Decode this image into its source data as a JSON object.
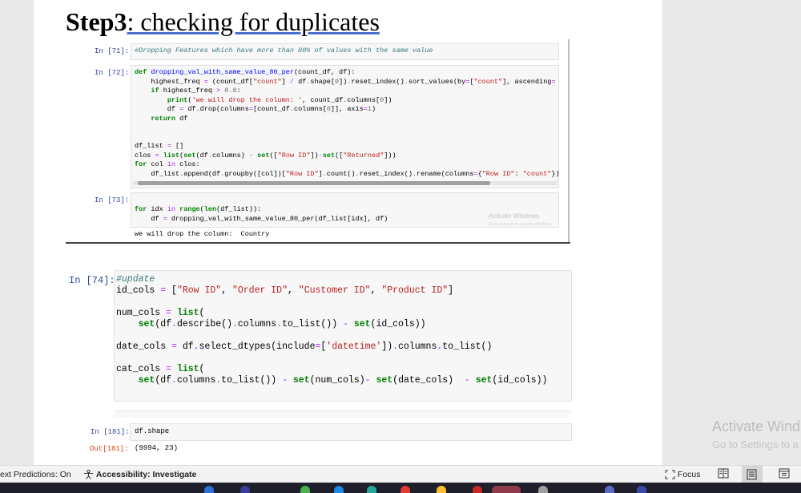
{
  "document": {
    "title_bold": "Step3",
    "title_rest": ": checking for duplicates"
  },
  "small_notebook": {
    "cells": [
      {
        "prompt": "In [71]:",
        "code": "#Dropping Features which have more than 80% of values with the same value"
      },
      {
        "prompt": "In [72]:",
        "lines": [
          "def dropping_val_with_same_value_80_per(count_df, df):",
          "    highest_freq = (count_df[\"count\"] / df.shape[0]).reset_index().sort_values(by=[\"count\"], ascending=",
          "    if highest_freq > 0.8:",
          "        print('we will drop the column: ', count_df.columns[0])",
          "        df = df.drop(columns=[count_df.columns[0]], axis=1)",
          "    return df",
          "",
          "",
          "df_list = []",
          "clos = list(set(df.columns) - set([\"Row ID\"])-set([\"Returned\"]))",
          "for col in clos:",
          "    df_list.append(df.groupby([col])[\"Row ID\"].count().reset_index().rename(columns={\"Row ID\": \"count\"})"
        ]
      },
      {
        "prompt": "In [73]:",
        "lines": [
          "for idx in range(len(df_list)):",
          "    df = dropping_val_with_same_value_80_per(df_list[idx], df)"
        ],
        "output": "we will drop the column:  Country"
      }
    ],
    "watermark_line1": "Activate Windows",
    "watermark_line2": "Go to Settings to activate Windows."
  },
  "main_cell": {
    "prompt": "In [74]:",
    "lines": [
      "#update",
      "id_cols = [\"Row ID\", \"Order ID\", \"Customer ID\", \"Product ID\"]",
      "",
      "num_cols = list(",
      "    set(df.describe().columns.to_list()) - set(id_cols))",
      "",
      "date_cols = df.select_dtypes(include=['datetime']).columns.to_list()",
      "",
      "cat_cols = list(",
      "    set(df.columns.to_list()) - set(num_cols)- set(date_cols)  - set(id_cols))"
    ]
  },
  "shape_cell": {
    "in_prompt": "In [181]:",
    "code": "df.shape",
    "out_prompt": "Out[181]:",
    "output": "(9994, 23)"
  },
  "activate_windows": {
    "line1": "Activate Wind",
    "line2": "Go to Settings to a"
  },
  "statusbar": {
    "text_predictions": "ext Predictions: On",
    "accessibility": "Accessibility: Investigate",
    "focus": "Focus"
  }
}
